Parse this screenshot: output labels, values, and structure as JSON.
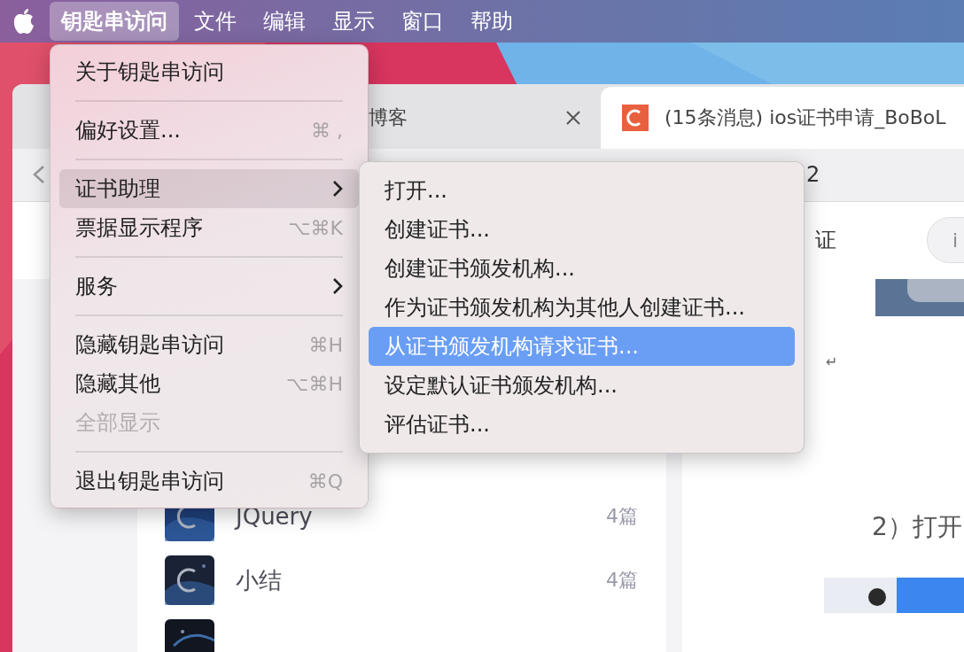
{
  "menu_bar": {
    "items": [
      {
        "label": "钥匙串访问",
        "selected": true
      },
      {
        "label": "文件",
        "selected": false
      },
      {
        "label": "编辑",
        "selected": false
      },
      {
        "label": "显示",
        "selected": false
      },
      {
        "label": "窗口",
        "selected": false
      },
      {
        "label": "帮助",
        "selected": false
      }
    ]
  },
  "app_menu": {
    "items": [
      {
        "kind": "item",
        "label": "关于钥匙串访问",
        "selected": false,
        "disabled": false,
        "submenu": false
      },
      {
        "kind": "separator"
      },
      {
        "kind": "item",
        "label": "偏好设置...",
        "shortcut": "⌘ ,",
        "selected": false,
        "disabled": false,
        "submenu": false
      },
      {
        "kind": "separator"
      },
      {
        "kind": "item",
        "label": "证书助理",
        "selected": true,
        "disabled": false,
        "submenu": true
      },
      {
        "kind": "item",
        "label": "票据显示程序",
        "shortcut": "⌥⌘K",
        "selected": false,
        "disabled": false,
        "submenu": false
      },
      {
        "kind": "separator"
      },
      {
        "kind": "item",
        "label": "服务",
        "selected": false,
        "disabled": false,
        "submenu": true
      },
      {
        "kind": "separator"
      },
      {
        "kind": "item",
        "label": "隐藏钥匙串访问",
        "shortcut": "⌘H",
        "selected": false,
        "disabled": false,
        "submenu": false
      },
      {
        "kind": "item",
        "label": "隐藏其他",
        "shortcut": "⌥⌘H",
        "selected": false,
        "disabled": false,
        "submenu": false
      },
      {
        "kind": "item",
        "label": "全部显示",
        "selected": false,
        "disabled": true,
        "submenu": false
      },
      {
        "kind": "separator"
      },
      {
        "kind": "item",
        "label": "退出钥匙串访问",
        "shortcut": "⌘Q",
        "selected": false,
        "disabled": false,
        "submenu": false
      }
    ]
  },
  "submenu": {
    "items": [
      {
        "label": "打开...",
        "selected": false
      },
      {
        "label": "创建证书...",
        "selected": false
      },
      {
        "label": "创建证书颁发机构...",
        "selected": false
      },
      {
        "label": "作为证书颁发机构为其他人创建证书...",
        "selected": false
      },
      {
        "label": "从证书颁发机构请求证书...",
        "selected": true
      },
      {
        "label": "设定默认证书颁发机构...",
        "selected": false
      },
      {
        "label": "评估证书...",
        "selected": false
      }
    ]
  },
  "browser": {
    "tabs": [
      {
        "title": "博客",
        "selected": false
      },
      {
        "title": "(15条消息) ios证书申请_BoBoL",
        "selected": true
      }
    ],
    "address_text": "2",
    "header_text": "证",
    "search_text": "i",
    "sidebar": {
      "rows": [
        {
          "title": "JQuery",
          "count": "4篇"
        },
        {
          "title": "小结",
          "count": "4篇"
        }
      ]
    },
    "article": {
      "return_mark": "↵",
      "text": "2）打开"
    }
  }
}
